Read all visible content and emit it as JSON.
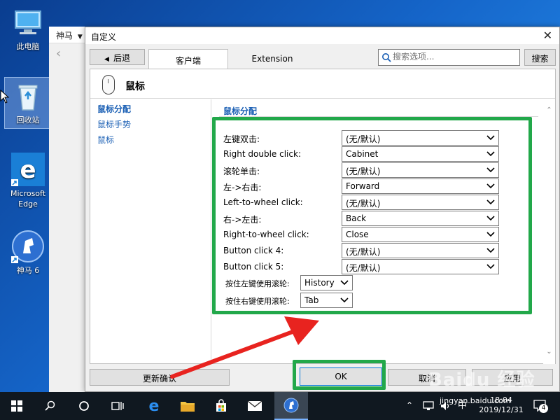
{
  "desktop": {
    "icons": [
      {
        "label": "此电脑"
      },
      {
        "label": "回收站"
      },
      {
        "label": "Microsoft Edge"
      },
      {
        "label": "神马 6"
      }
    ]
  },
  "background_window": {
    "title": "神马"
  },
  "dialog": {
    "title": "自定义",
    "back_label": "后退",
    "tabs": [
      "客户端",
      "Extension"
    ],
    "search_placeholder": "搜索选项...",
    "search_button": "搜索",
    "section_title": "鼠标",
    "nav": [
      "鼠标分配",
      "鼠标手势",
      "鼠标"
    ],
    "group_title": "鼠标分配",
    "rows": [
      {
        "label": "左键双击:",
        "value": "(无/默认)"
      },
      {
        "label": "Right double click:",
        "value": "Cabinet"
      },
      {
        "label": "滚轮单击:",
        "value": "(无/默认)"
      },
      {
        "label": "左->右击:",
        "value": "Forward"
      },
      {
        "label": "Left-to-wheel click:",
        "value": "(无/默认)"
      },
      {
        "label": "右->左击:",
        "value": "Back"
      },
      {
        "label": "Right-to-wheel click:",
        "value": "Close"
      },
      {
        "label": "Button click 4:",
        "value": "(无/默认)"
      },
      {
        "label": "Button click 5:",
        "value": "(无/默认)"
      }
    ],
    "scroll_rows": [
      {
        "label": "按住左键使用滚轮:",
        "value": "History"
      },
      {
        "label": "按住右键使用滚轮:",
        "value": "Tab"
      }
    ],
    "buttons": {
      "update": "更新确认",
      "ok": "OK",
      "cancel": "取消",
      "apply": "应用"
    }
  },
  "taskbar": {
    "tray": {
      "ime_mode": "中",
      "time": "18:04",
      "date": "2019/12/31",
      "notifications": "4"
    }
  },
  "watermark": {
    "brand": "Baidu 经验",
    "url": "jingyan.baidu.com"
  },
  "colors": {
    "highlight_box": "#22a84a",
    "arrow": "#e8231f",
    "link": "#1a5fb4"
  }
}
